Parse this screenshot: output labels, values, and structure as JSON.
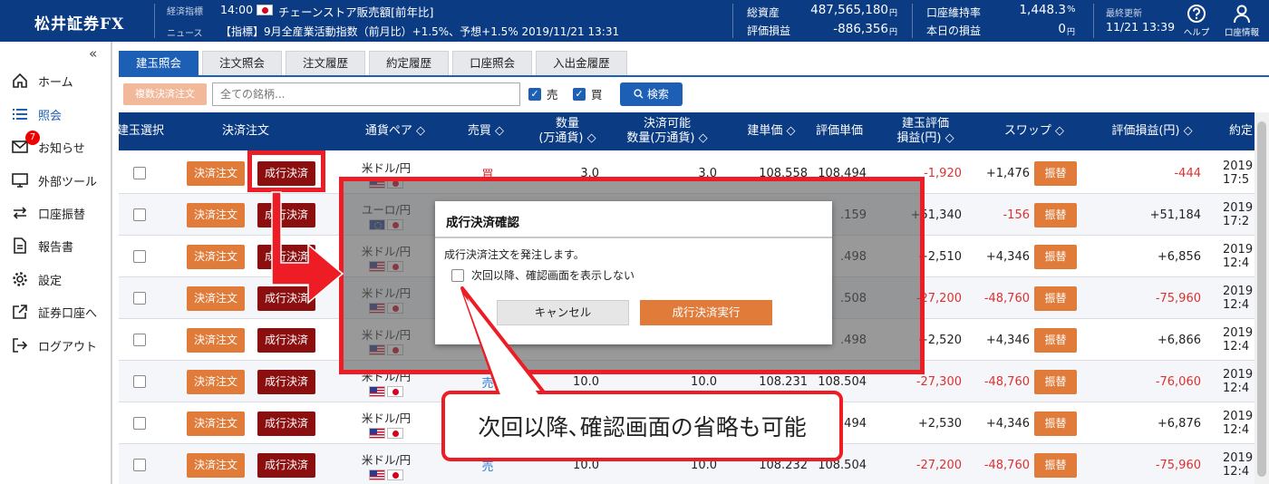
{
  "header": {
    "logo": "松井証券FX",
    "indicator_label": "経済指標",
    "indicator_time": "14:00",
    "indicator_text": "チェーンストア販売額[前年比]",
    "news_label": "ニュース",
    "news_text": "【指標】9月全産業活動指数（前月比）+1.5%、予想+1.5%  2019/11/21 13:31",
    "total_assets_label": "総資産",
    "total_assets_value": "487,565,180",
    "eval_pl_label": "評価損益",
    "eval_pl_value": "-886,356",
    "yen_unit": "円",
    "margin_rate_label": "口座維持率",
    "margin_rate_value": "1,448.3",
    "percent_unit": "%",
    "today_pl_label": "本日の損益",
    "today_pl_value": "0",
    "last_update_label": "最終更新",
    "last_update_value": "11/21 13:39",
    "help_label": "ヘルプ",
    "account_label": "口座情報"
  },
  "sidebar": {
    "collapse_icon": "«",
    "items": [
      {
        "label": "ホーム",
        "icon": "home-icon"
      },
      {
        "label": "照会",
        "icon": "list-icon"
      },
      {
        "label": "お知らせ",
        "icon": "mail-icon",
        "badge": "7"
      },
      {
        "label": "外部ツール",
        "icon": "monitor-icon"
      },
      {
        "label": "口座振替",
        "icon": "transfer-icon"
      },
      {
        "label": "報告書",
        "icon": "document-icon"
      },
      {
        "label": "設定",
        "icon": "gear-icon"
      },
      {
        "label": "証券口座へ",
        "icon": "external-link-icon"
      },
      {
        "label": "ログアウト",
        "icon": "logout-icon"
      }
    ]
  },
  "tabs": [
    "建玉照会",
    "注文照会",
    "注文履歴",
    "約定履歴",
    "口座照会",
    "入出金履歴"
  ],
  "toolbar": {
    "bulk_button": "複数決済注文",
    "search_placeholder": "全ての銘柄...",
    "sell_label": "売",
    "buy_label": "買",
    "search_button": "検索"
  },
  "table": {
    "headers": {
      "select": "建玉選択",
      "order": "決済注文",
      "pair": "通貨ペア ◇",
      "side": "売買 ◇",
      "qty_1": "数量",
      "qty_2": "(万通貨) ◇",
      "avail_1": "決済可能",
      "avail_2": "数量(万通貨) ◇",
      "open_price": "建単価 ◇",
      "eval_price": "評価単価",
      "pos_pl_1": "建玉評価",
      "pos_pl_2": "損益(円) ◇",
      "swap": "スワップ ◇",
      "eval_pl": "評価損益(円) ◇",
      "exec": "約定"
    },
    "close_btn": "決済注文",
    "market_btn": "成行決済",
    "swap_btn": "振替",
    "rows": [
      {
        "pair": "米ドル/円",
        "flag": "us",
        "side": "買",
        "side_type": "buy",
        "qty": "3.0",
        "avail": "3.0",
        "open": "108.558",
        "eval": "108.494",
        "pos_pl": "-1,920",
        "swap": "+1,476",
        "total": "-444",
        "d1": "2019,",
        "d2": "17:5"
      },
      {
        "pair": "ユーロ/円",
        "flag": "eu",
        "side": "",
        "side_type": "",
        "qty": "",
        "avail": "",
        "open": "",
        "eval": ".159",
        "pos_pl": "+51,340",
        "swap": "-156",
        "total": "+51,184",
        "d1": "2019,",
        "d2": "17:2"
      },
      {
        "pair": "米ドル/円",
        "flag": "us",
        "side": "",
        "side_type": "",
        "qty": "",
        "avail": "",
        "open": "",
        "eval": ".498",
        "pos_pl": "+2,510",
        "swap": "+4,346",
        "total": "+6,856",
        "d1": "2019,",
        "d2": "12:4"
      },
      {
        "pair": "米ドル/円",
        "flag": "us",
        "side": "",
        "side_type": "",
        "qty": "",
        "avail": "",
        "open": "",
        "eval": ".508",
        "pos_pl": "-27,200",
        "swap": "-48,760",
        "total": "-75,960",
        "d1": "2019,",
        "d2": "12:4"
      },
      {
        "pair": "米ドル/円",
        "flag": "us",
        "side": "",
        "side_type": "",
        "qty": "",
        "avail": "",
        "open": "",
        "eval": ".498",
        "pos_pl": "+2,520",
        "swap": "+4,346",
        "total": "+6,866",
        "d1": "2019,",
        "d2": "12:4"
      },
      {
        "pair": "米ドル/円",
        "flag": "us",
        "side": "売",
        "side_type": "sell",
        "qty": "10.0",
        "avail": "10.0",
        "open": "108.231",
        "eval": "108.504",
        "pos_pl": "-27,300",
        "swap": "-48,760",
        "total": "-76,060",
        "d1": "2019,",
        "d2": "12:4"
      },
      {
        "pair": "米ドル/円",
        "flag": "us",
        "side": "",
        "side_type": "",
        "qty": "",
        "avail": "",
        "open": "",
        "eval": ".494",
        "pos_pl": "+2,530",
        "swap": "+4,346",
        "total": "+6,876",
        "d1": "2019,",
        "d2": "12:4"
      },
      {
        "pair": "米ドル/円",
        "flag": "us",
        "side": "売",
        "side_type": "sell",
        "qty": "10.0",
        "avail": "10.0",
        "open": "108.232",
        "eval": "108.504",
        "pos_pl": "-27,200",
        "swap": "-48,760",
        "total": "-75,960",
        "d1": "2019,",
        "d2": "12:4"
      }
    ]
  },
  "dialog": {
    "title": "成行決済確認",
    "message": "成行決済注文を発注します。",
    "checkbox_label": "次回以降、確認画面を表示しない",
    "cancel": "キャンセル",
    "execute": "成行決済実行"
  },
  "callout": {
    "text": "次回以降､確認画面の省略も可能"
  },
  "colors": {
    "header_bg": "#0b3b83",
    "accent_blue": "#1d5fb5",
    "orange": "#e07b3a",
    "dark_red": "#8b0f0f",
    "annotation_red": "#ee1c24"
  }
}
